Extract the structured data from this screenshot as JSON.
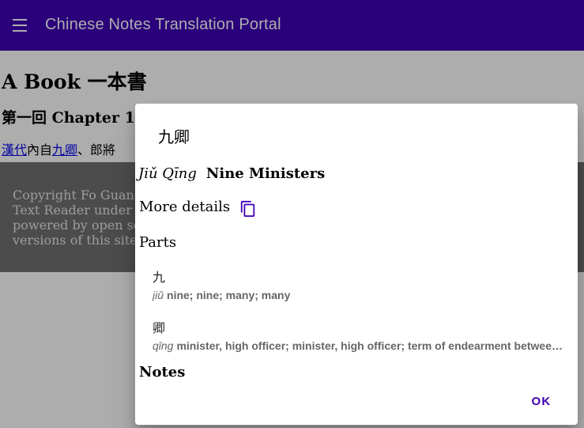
{
  "appbar": {
    "title": "Chinese Notes Translation Portal"
  },
  "page": {
    "book_title": "A Book 一本書",
    "chapter_title": "第一回 Chapter 1",
    "text": {
      "link1": "漢代",
      "mid": "內自",
      "link2": "九卿",
      "tail": "、郎將"
    },
    "footer_lines": [
      "Copyright Fo Guang",
      "Text Reader under",
      "powered by open so",
      "versions of this site"
    ]
  },
  "dialog": {
    "title": "九卿",
    "pinyin": "Jiǔ Qīng",
    "english": "Nine Ministers",
    "more_details": "More details",
    "parts_label": "Parts",
    "parts": [
      {
        "char": "九",
        "pinyin": "jiǔ",
        "english": "nine; nine; many; many"
      },
      {
        "char": "卿",
        "pinyin": "qīng",
        "english": "minister, high officer; minister, high officer; term of endearment betwee…"
      }
    ],
    "notes_label": "Notes",
    "ok_label": "OK"
  },
  "colors": {
    "primary": "#3f00b5",
    "scrim": "rgba(0,0,0,0.32)"
  },
  "icons": {
    "menu": "menu-icon",
    "copy": "copy-icon"
  }
}
